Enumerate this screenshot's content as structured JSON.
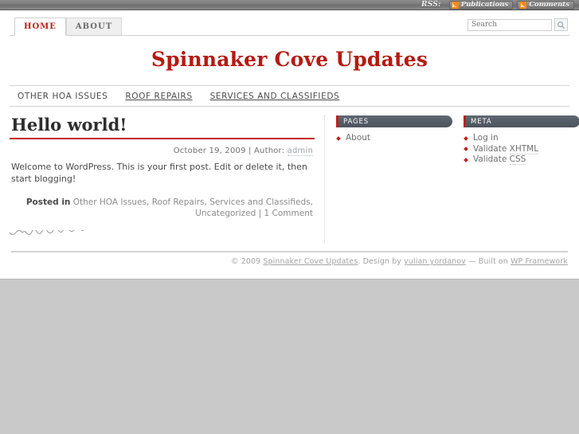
{
  "rss_bar": {
    "label": "RSS:",
    "chips": [
      {
        "icon": "feed-icon",
        "label": "Publications"
      },
      {
        "icon": "feed-icon",
        "label": "Comments"
      }
    ]
  },
  "tabs": [
    {
      "label": "HOME",
      "active": true
    },
    {
      "label": "ABOUT",
      "active": false
    }
  ],
  "search": {
    "value": "",
    "placeholder": "Search",
    "button_icon": "search-icon"
  },
  "header": {
    "site_title": "Spinnaker Cove Updates",
    "title_color": "#b51a12"
  },
  "main_nav": [
    {
      "label": "OTHER HOA ISSUES",
      "underline": false
    },
    {
      "label": "ROOF REPAIRS",
      "underline": true
    },
    {
      "label": "SERVICES AND CLASSIFIEDS",
      "underline": true
    }
  ],
  "post": {
    "title": "Hello world!",
    "date": "October 19, 2009",
    "meta_separator": "|",
    "author_label": "Author:",
    "author": "admin",
    "body": "Welcome to WordPress. This is your first post. Edit or delete it, then start blogging!",
    "posted_in_label": "Posted in",
    "categories": [
      "Other HOA Issues",
      "Roof Repairs",
      "Services and Classifieds",
      "Uncategorized"
    ],
    "comments_separator": "|",
    "comments": "1 Comment"
  },
  "sidebar": {
    "widgets": [
      {
        "title": "PAGES",
        "items": [
          {
            "label": "About",
            "underline": false
          }
        ]
      },
      {
        "title": "META",
        "items": [
          {
            "label": "Log in",
            "underline": false
          },
          {
            "label": "Validate XHTML",
            "underline": true,
            "plain": "Validate ",
            "link": "XHTML"
          },
          {
            "label": "Validate CSS",
            "underline": true,
            "plain": "Validate ",
            "link": "CSS"
          }
        ]
      }
    ]
  },
  "footer": {
    "copyright": "© 2009",
    "site_link": "Spinnaker Cove Updates",
    "design_by": ". Design by",
    "designer": "yulian yordanov",
    "built_on": "— Built on",
    "framework": "WP Framework"
  }
}
